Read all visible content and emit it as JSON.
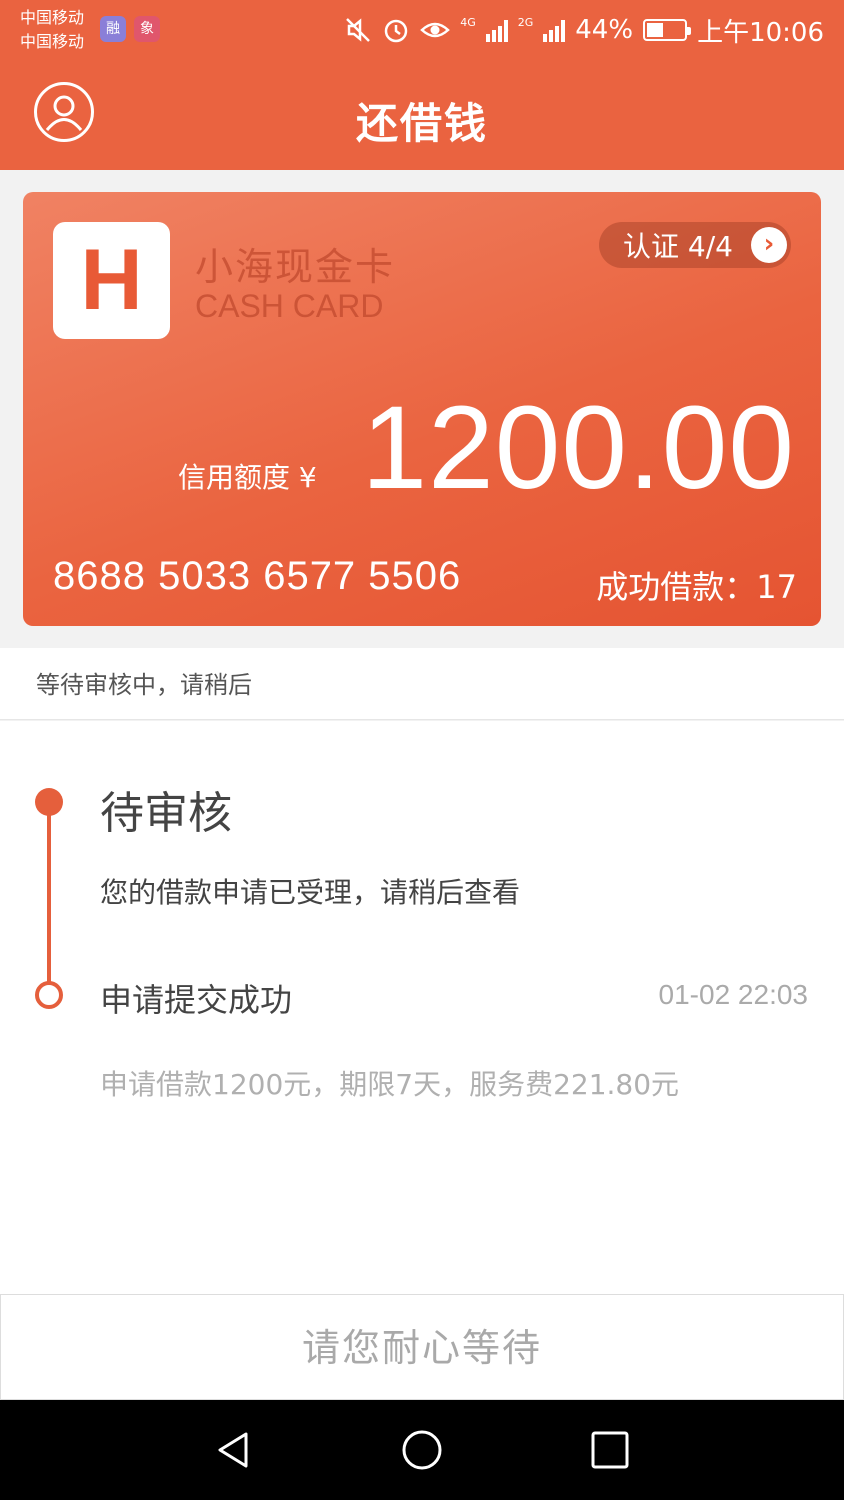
{
  "status_bar": {
    "carrier_1": "中国移动",
    "carrier_2": "中国移动",
    "app_icon_1": "融",
    "app_icon_2": "象",
    "network_1": "4G",
    "network_2": "2G",
    "battery": "44%",
    "battery_level": 0.44,
    "time": "上午10:06",
    "icons": [
      "mute-icon",
      "alarm-icon",
      "eye-icon",
      "signal-icon",
      "battery-icon"
    ]
  },
  "header": {
    "title": "还借钱",
    "avatar_icon": "user-icon"
  },
  "card": {
    "logo_letter": "H",
    "name": "小海现金卡",
    "subname": "CASH CARD",
    "certification": "认证 4/4",
    "credit_label": "信用额度 ¥",
    "credit_amount": "1200.00",
    "card_number": "8688 5033 6577 5506",
    "success_loans": "成功借款：17"
  },
  "notice": "等待审核中，请稍后",
  "timeline": [
    {
      "title": "待审核",
      "description": "您的借款申请已受理，请稍后查看",
      "time": ""
    },
    {
      "title": "申请提交成功",
      "description": "申请借款1200元，期限7天，服务费221.80元",
      "time": "01-02 22:03"
    }
  ],
  "wait_button": "请您耐心等待",
  "colors": {
    "accent": "#ea6340",
    "timeline": "#e55f3c"
  }
}
